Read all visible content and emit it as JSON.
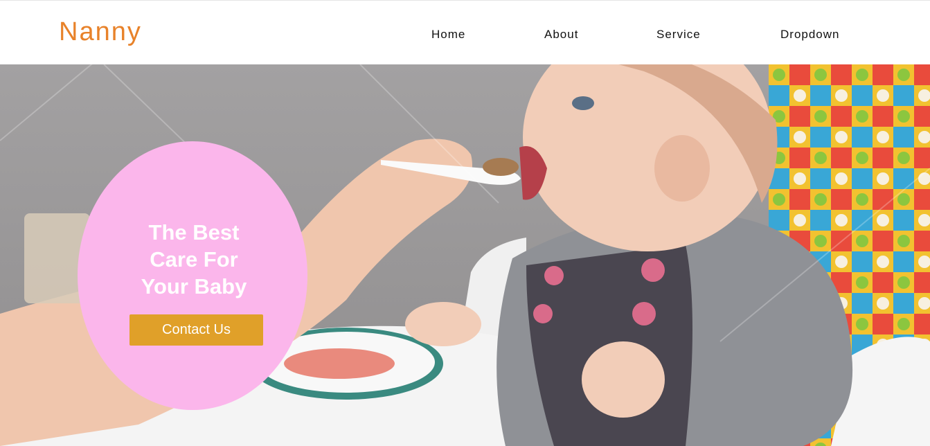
{
  "brand": {
    "name": "Nanny",
    "color": "#e8822a"
  },
  "nav": {
    "items": [
      {
        "label": "Home"
      },
      {
        "label": "About"
      },
      {
        "label": "Service"
      },
      {
        "label": "Dropdown"
      }
    ]
  },
  "hero": {
    "title_lines": [
      "The Best",
      "Care For",
      "Your Baby"
    ],
    "cta_label": "Contact Us",
    "bubble_color": "#fbb6eb",
    "cta_color": "#e0a029",
    "image": "baby-being-spoon-fed-photo"
  }
}
